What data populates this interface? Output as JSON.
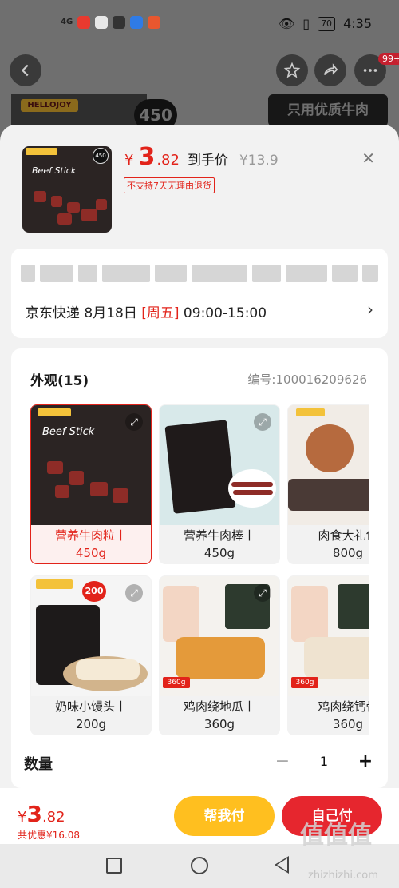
{
  "status_bar": {
    "signal": "4G",
    "time": "4:35",
    "battery": "70"
  },
  "background": {
    "badge_count": "99+",
    "product_brand": "HELLOJOY",
    "product_weight": "450",
    "banner_text": "只用优质牛肉"
  },
  "sheet": {
    "product": {
      "brand": "HELLOJOY",
      "image_weight": "450",
      "image_title": "Beef Stick",
      "currency": "¥",
      "price_int": "3",
      "price_dec": ".82",
      "price_label": "到手价",
      "original_price": "¥13.9",
      "no_return_tag": "不支持7天无理由退货"
    },
    "address": {
      "delivery_prefix": "京东快递 8月18日 ",
      "delivery_weekday": "[周五]",
      "delivery_window": " 09:00-15:00"
    },
    "options": {
      "title": "外观(15)",
      "code": "编号:100016209626",
      "items": [
        {
          "name": "营养牛肉粒丨",
          "size": "450g"
        },
        {
          "name": "营养牛肉棒丨",
          "size": "450g"
        },
        {
          "name": "肉食大礼包",
          "size": "800g"
        },
        {
          "name": "奶味小馒头丨",
          "size": "200g"
        },
        {
          "name": "鸡肉绕地瓜丨",
          "size": "360g"
        },
        {
          "name": "鸡肉绕钙骨",
          "size": "360g"
        }
      ],
      "tile_labels": {
        "beef_stick": "Beef Stick",
        "jar_weight": "200",
        "bag_weight": "360g"
      }
    },
    "quantity": {
      "label": "数量",
      "value": "1",
      "minus": "−",
      "plus": "+"
    }
  },
  "bottom": {
    "currency": "¥",
    "total_int": "3",
    "total_dec": ".82",
    "saved": "共优惠¥16.08",
    "help_pay": "帮我付",
    "self_pay": "自己付"
  },
  "watermark": {
    "main": "值值值",
    "sub": "zhizhizhi.com"
  },
  "colors": {
    "accent": "#e2231a",
    "help_button": "#ffbf1f",
    "pay_button": "#e6262e"
  }
}
